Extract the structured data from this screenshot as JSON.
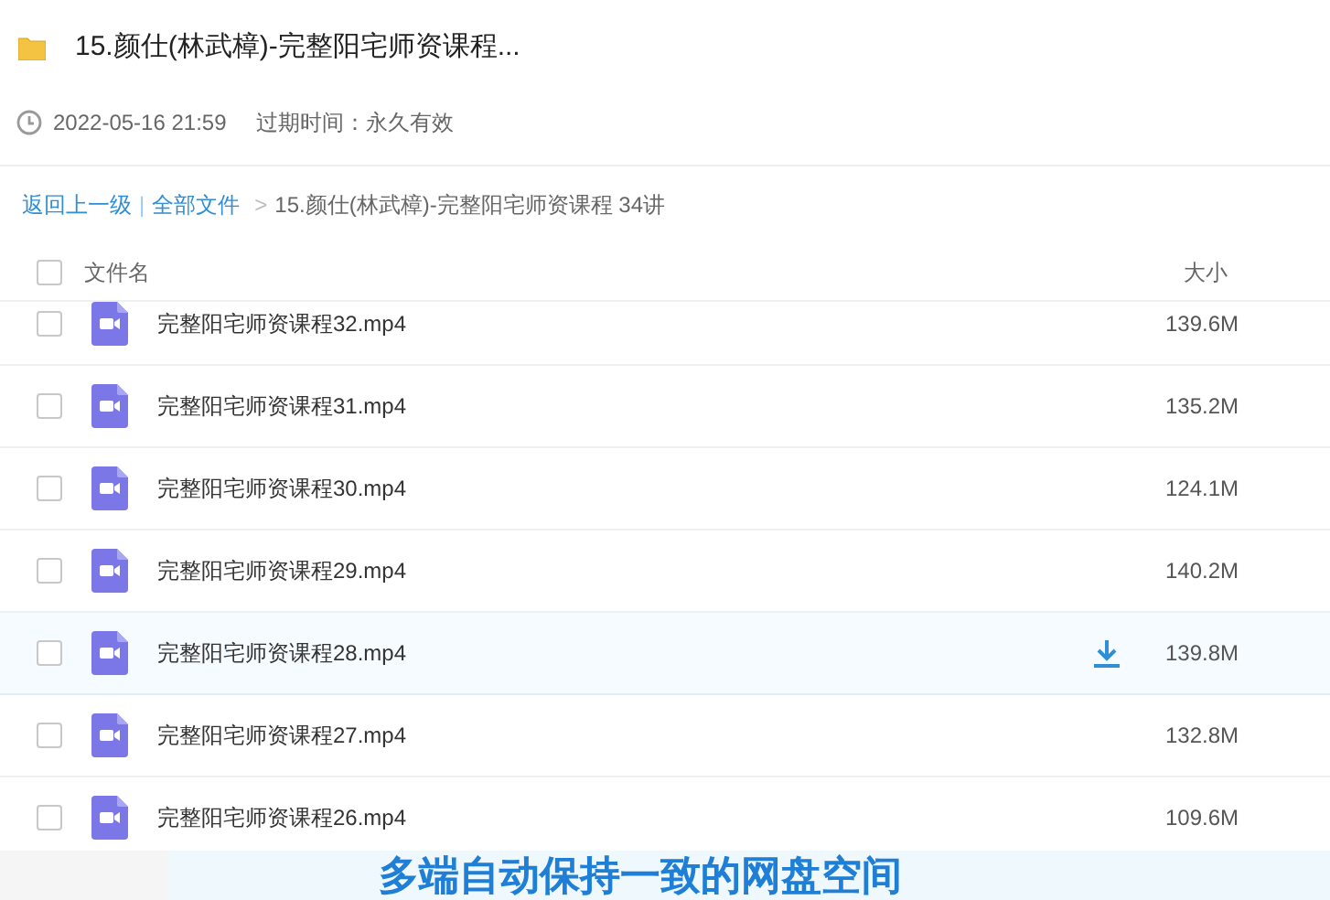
{
  "share": {
    "title": "15.颜仕(林武樟)-完整阳宅师资课程...",
    "time": "2022-05-16 21:59",
    "expiry": "过期时间：永久有效"
  },
  "breadcrumb": {
    "back": "返回上一级",
    "separator": "|",
    "root": "全部文件",
    "arrow": ">",
    "current": "15.颜仕(林武樟)-完整阳宅师资课程 34讲"
  },
  "table": {
    "columns": [
      "文件名",
      "大小"
    ],
    "header_checked": false,
    "rows": [
      {
        "name": "完整阳宅师资课程32.mp4",
        "size": "139.6M",
        "checked": false,
        "hovered": false
      },
      {
        "name": "完整阳宅师资课程31.mp4",
        "size": "135.2M",
        "checked": false,
        "hovered": false
      },
      {
        "name": "完整阳宅师资课程30.mp4",
        "size": "124.1M",
        "checked": false,
        "hovered": false
      },
      {
        "name": "完整阳宅师资课程29.mp4",
        "size": "140.2M",
        "checked": false,
        "hovered": false
      },
      {
        "name": "完整阳宅师资课程28.mp4",
        "size": "139.8M",
        "checked": false,
        "hovered": true
      },
      {
        "name": "完整阳宅师资课程27.mp4",
        "size": "132.8M",
        "checked": false,
        "hovered": false
      },
      {
        "name": "完整阳宅师资课程26.mp4",
        "size": "109.6M",
        "checked": false,
        "hovered": false
      }
    ]
  },
  "banner": {
    "text": "多端自动保持一致的网盘空间"
  }
}
